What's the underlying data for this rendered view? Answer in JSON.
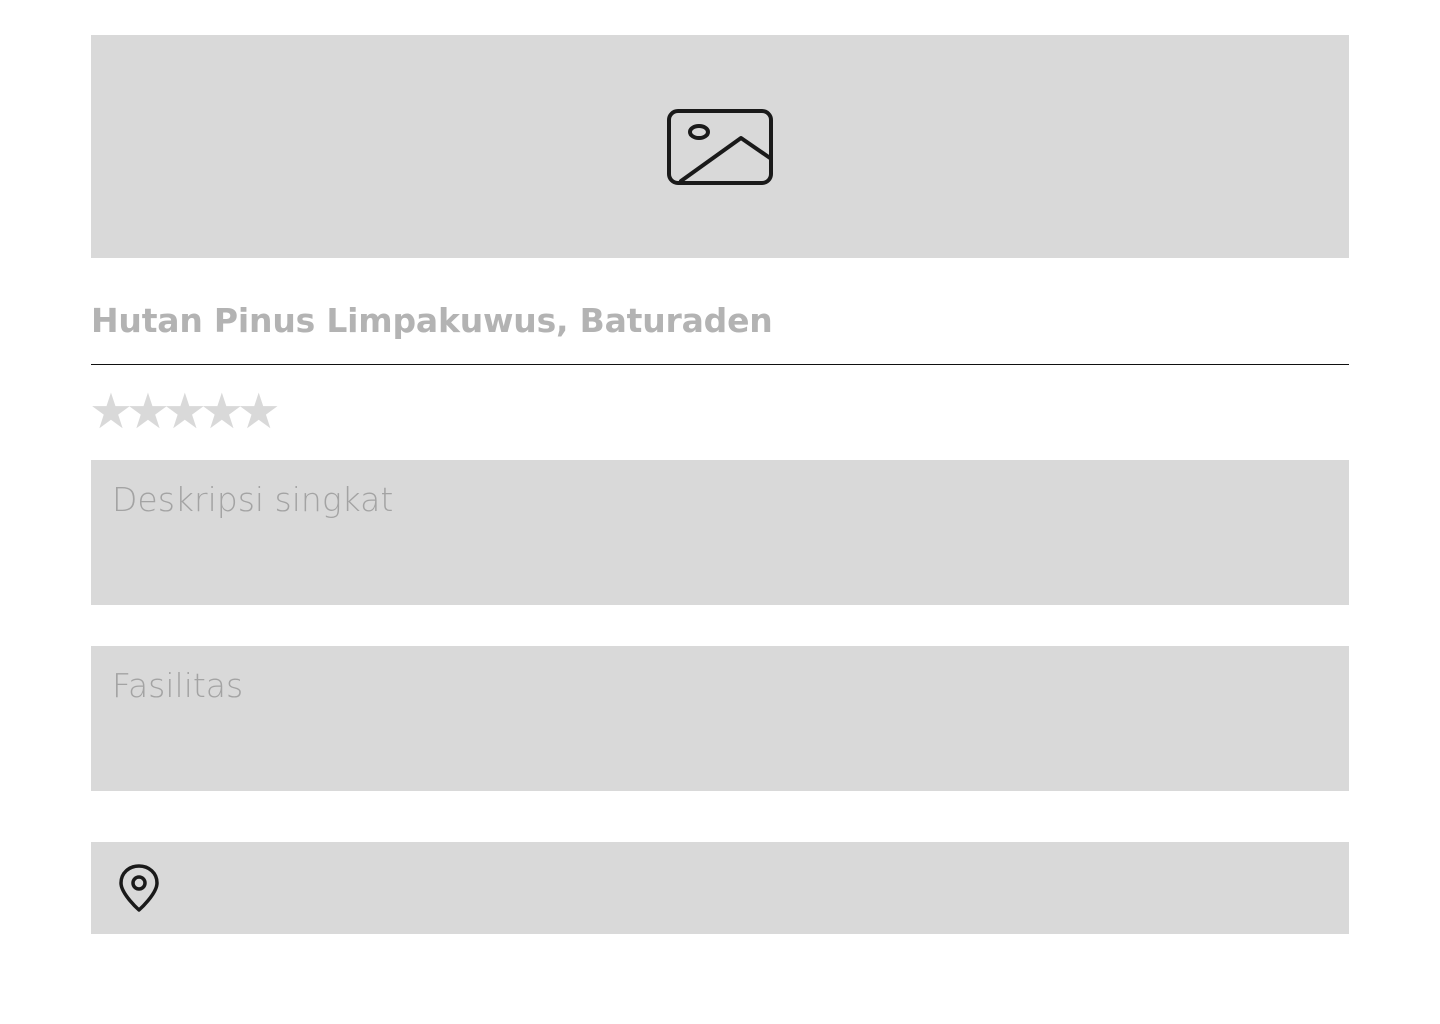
{
  "image_upload": {
    "icon": "image-icon"
  },
  "place": {
    "title": "Hutan Pinus Limpakuwus, Baturaden"
  },
  "rating": {
    "icon": "star-icon",
    "max": 5,
    "value": 0,
    "star_glyph": "★",
    "star_color": "#d9d9d9"
  },
  "description": {
    "placeholder": "Deskripsi singkat",
    "value": ""
  },
  "facilities": {
    "placeholder": "Fasilitas",
    "value": ""
  },
  "location": {
    "icon": "map-pin-icon",
    "value": ""
  },
  "colors": {
    "panel_background": "#d9d9d9",
    "title_text": "#b3b3b3",
    "placeholder_text": "#a3a3a3",
    "icon_stroke": "#1a1a1a",
    "divider": "#111111"
  }
}
